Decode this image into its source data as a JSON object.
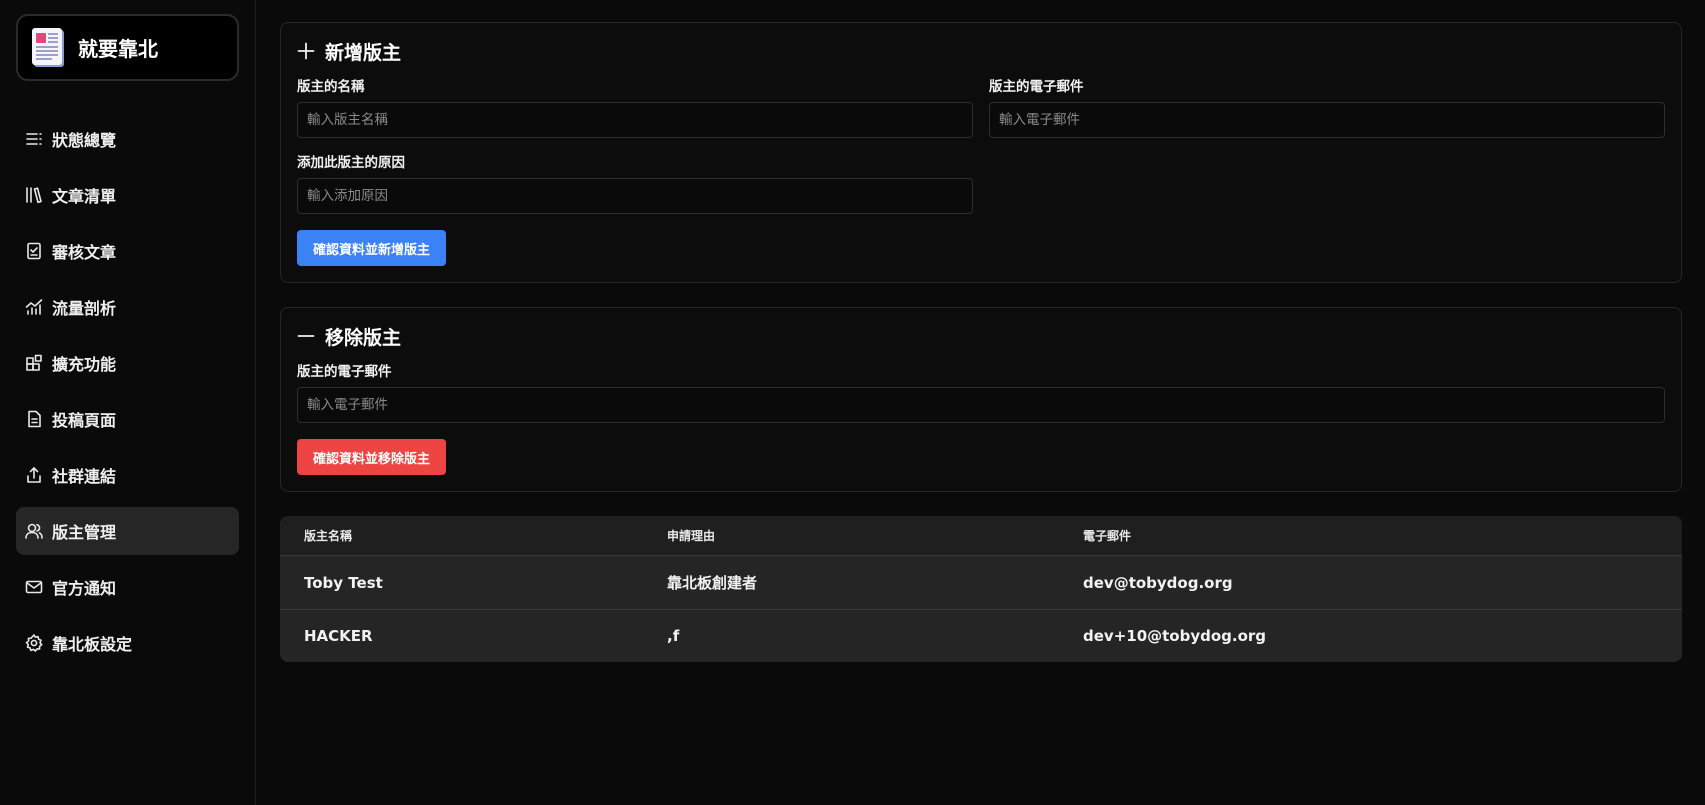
{
  "brand": {
    "name": "就要靠北"
  },
  "sidebar": {
    "items": [
      {
        "label": "狀態總覽",
        "icon": "list-icon"
      },
      {
        "label": "文章清單",
        "icon": "library-icon"
      },
      {
        "label": "審核文章",
        "icon": "clipboard-check-icon"
      },
      {
        "label": "流量剖析",
        "icon": "chart-icon"
      },
      {
        "label": "擴充功能",
        "icon": "blocks-icon"
      },
      {
        "label": "投稿頁面",
        "icon": "file-text-icon"
      },
      {
        "label": "社群連結",
        "icon": "share-icon"
      },
      {
        "label": "版主管理",
        "icon": "users-icon",
        "active": true
      },
      {
        "label": "官方通知",
        "icon": "mail-icon"
      },
      {
        "label": "靠北板設定",
        "icon": "gear-icon"
      }
    ]
  },
  "add_section": {
    "title": "新增版主",
    "name_label": "版主的名稱",
    "name_placeholder": "輸入版主名稱",
    "email_label": "版主的電子郵件",
    "email_placeholder": "輸入電子郵件",
    "reason_label": "添加此版主的原因",
    "reason_placeholder": "輸入添加原因",
    "submit_label": "確認資料並新增版主",
    "accent": "#3b82f6"
  },
  "remove_section": {
    "title": "移除版主",
    "email_label": "版主的電子郵件",
    "email_placeholder": "輸入電子郵件",
    "submit_label": "確認資料並移除版主",
    "accent": "#ef4444"
  },
  "table": {
    "headers": [
      "版主名稱",
      "申請理由",
      "電子郵件"
    ],
    "rows": [
      [
        "Toby Test",
        "靠北板創建者",
        "dev@tobydog.org"
      ],
      [
        "HACKER",
        ",f",
        "dev+10@tobydog.org"
      ]
    ]
  }
}
